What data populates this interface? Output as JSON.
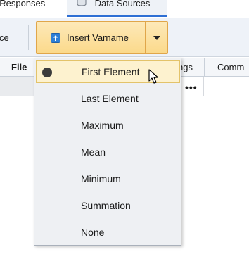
{
  "tabs": [
    {
      "label": "t Responses",
      "active": false
    },
    {
      "label": "Data Sources",
      "active": true
    }
  ],
  "toolbar": {
    "left_text": "ce",
    "insert_varname_label": "Insert Varname"
  },
  "grid": {
    "columns": [
      "File",
      "ngs",
      "Comm"
    ],
    "row_cell_button": "•••"
  },
  "menu": {
    "items": [
      {
        "label": "First Element",
        "selected": true
      },
      {
        "label": "Last Element",
        "selected": false
      },
      {
        "label": "Maximum",
        "selected": false
      },
      {
        "label": "Mean",
        "selected": false
      },
      {
        "label": "Minimum",
        "selected": false
      },
      {
        "label": "Summation",
        "selected": false
      },
      {
        "label": "None",
        "selected": false
      }
    ]
  },
  "colors": {
    "accent": "#2e6fd4",
    "button_border": "#e0a64a",
    "menu_selected_bg": "#fdf2cf"
  },
  "icons": {
    "data_sources_tab": "database-icon",
    "insert_varname": "upload-icon",
    "split_dropdown": "chevron-down-icon",
    "selected_marker": "radio-dot-icon",
    "pointer": "cursor-icon"
  }
}
